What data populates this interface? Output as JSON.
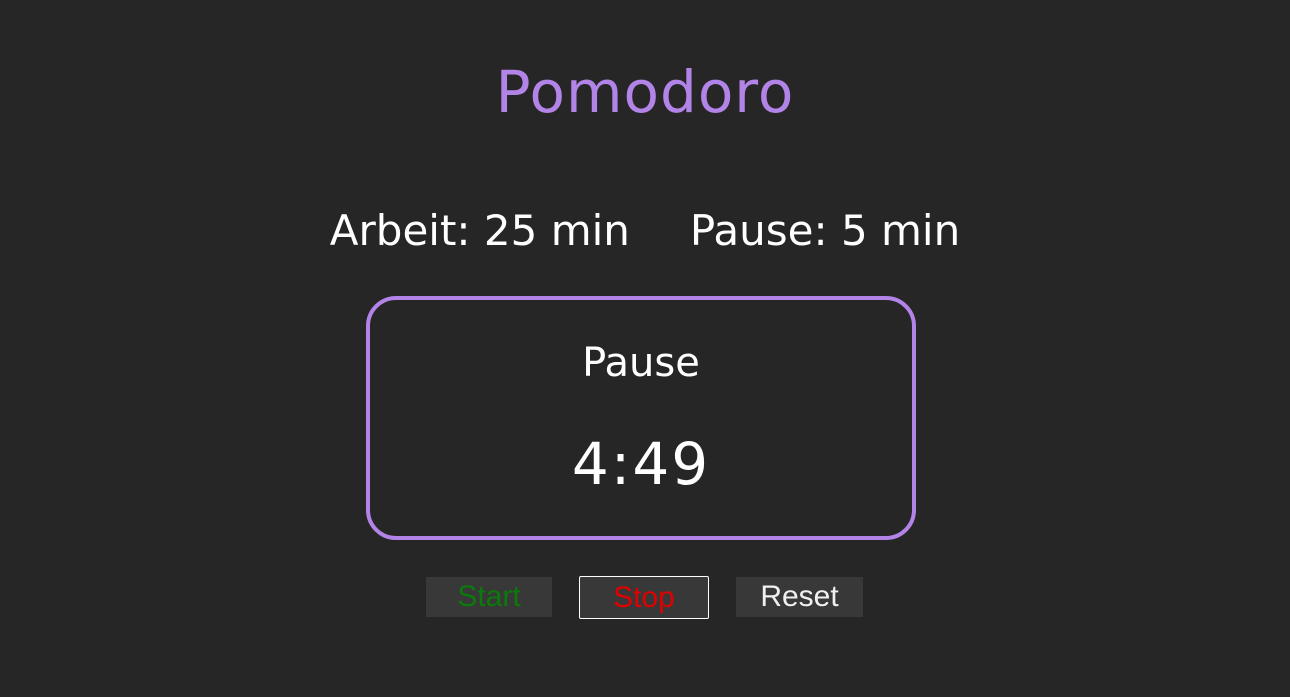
{
  "app": {
    "title": "Pomodoro"
  },
  "settings": {
    "work_label": "Arbeit: 25 min",
    "break_label": "Pause: 5 min"
  },
  "timer": {
    "phase": "Pause",
    "remaining": "4:49"
  },
  "controls": {
    "start_label": "Start",
    "stop_label": "Stop",
    "reset_label": "Reset"
  },
  "colors": {
    "background": "#262626",
    "accent": "#b384e8",
    "start": "#0a7a0a",
    "stop": "#e00000",
    "button_bg": "#383838"
  }
}
